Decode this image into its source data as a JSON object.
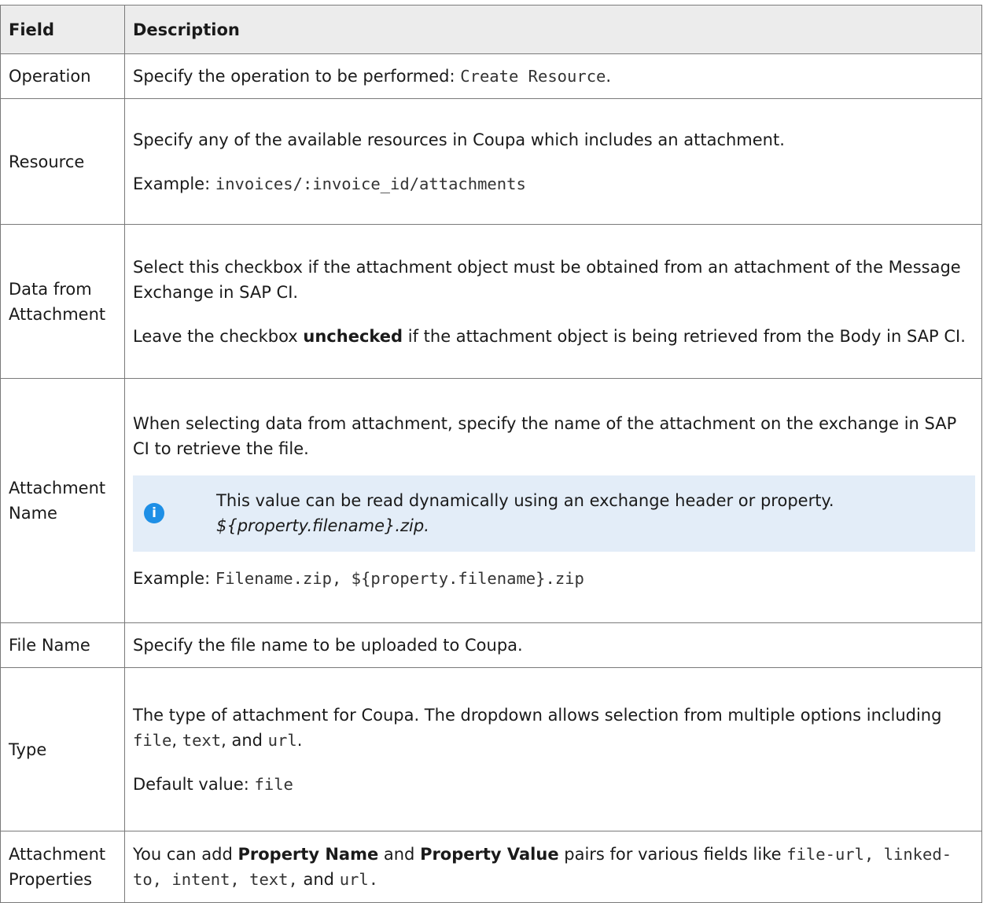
{
  "headers": {
    "field": "Field",
    "description": "Description"
  },
  "rows": {
    "operation": {
      "field": "Operation",
      "desc_prefix": "Specify the operation to be performed: ",
      "desc_code": "Create Resource",
      "desc_suffix": "."
    },
    "resource": {
      "field": "Resource",
      "desc": "Specify any of the available resources in Coupa which includes an attachment.",
      "example_label": "Example: ",
      "example_code": "invoices/:invoice_id/attachments"
    },
    "data_from_attachment": {
      "field": "Data from Attachment",
      "desc1": "Select this checkbox if the attachment object must be obtained from an attachment of the Message Exchange in SAP CI.",
      "desc2_prefix": "Leave the checkbox ",
      "desc2_bold": "unchecked",
      "desc2_suffix": " if the attachment object is being retrieved from the Body in SAP CI."
    },
    "attachment_name": {
      "field": "Attachment Name",
      "desc": "When selecting data from attachment, specify the name of the attachment on the exchange in SAP CI to retrieve the file.",
      "note_icon": "info-icon",
      "note_text": "This value can be read dynamically using an exchange header or property.",
      "note_italic": "${property.filename}.zip.",
      "example_label": "Example: ",
      "example_code": "Filename.zip, ${property.filename}.zip"
    },
    "file_name": {
      "field": "File Name",
      "desc": "Specify the file name to be uploaded to Coupa."
    },
    "type": {
      "field": "Type",
      "desc_prefix": "The type of attachment for Coupa. The dropdown allows selection from multiple options including ",
      "opt1": "file",
      "sep1": ", ",
      "opt2": "text",
      "sep2": ", and ",
      "opt3": "url",
      "desc_suffix": ".",
      "default_label": "Default value: ",
      "default_code": "file"
    },
    "attachment_properties": {
      "field": "Attachment Properties",
      "desc_prefix": "You can add ",
      "bold1": "Property Name",
      "mid": " and ",
      "bold2": "Property Value",
      "desc_mid2": " pairs for various fields like ",
      "code1": "file-url, linked-to, intent, text,",
      "and": " and ",
      "code2": "url."
    }
  }
}
